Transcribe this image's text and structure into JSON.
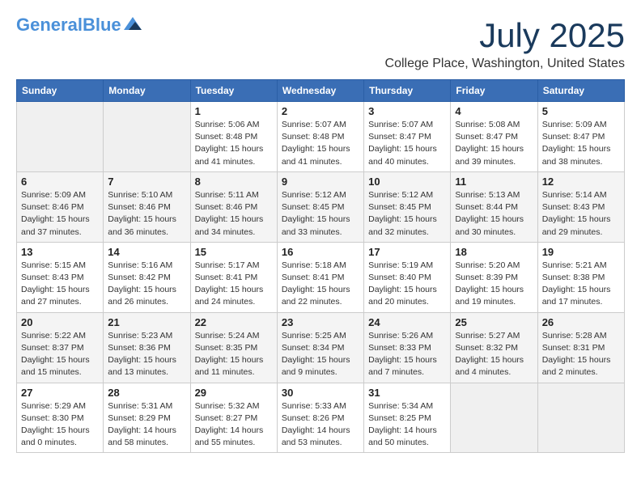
{
  "header": {
    "logo_general": "General",
    "logo_blue": "Blue",
    "month_title": "July 2025",
    "location": "College Place, Washington, United States"
  },
  "days_of_week": [
    "Sunday",
    "Monday",
    "Tuesday",
    "Wednesday",
    "Thursday",
    "Friday",
    "Saturday"
  ],
  "weeks": [
    [
      {
        "day": "",
        "sunrise": "",
        "sunset": "",
        "daylight": ""
      },
      {
        "day": "",
        "sunrise": "",
        "sunset": "",
        "daylight": ""
      },
      {
        "day": "1",
        "sunrise": "Sunrise: 5:06 AM",
        "sunset": "Sunset: 8:48 PM",
        "daylight": "Daylight: 15 hours and 41 minutes."
      },
      {
        "day": "2",
        "sunrise": "Sunrise: 5:07 AM",
        "sunset": "Sunset: 8:48 PM",
        "daylight": "Daylight: 15 hours and 41 minutes."
      },
      {
        "day": "3",
        "sunrise": "Sunrise: 5:07 AM",
        "sunset": "Sunset: 8:47 PM",
        "daylight": "Daylight: 15 hours and 40 minutes."
      },
      {
        "day": "4",
        "sunrise": "Sunrise: 5:08 AM",
        "sunset": "Sunset: 8:47 PM",
        "daylight": "Daylight: 15 hours and 39 minutes."
      },
      {
        "day": "5",
        "sunrise": "Sunrise: 5:09 AM",
        "sunset": "Sunset: 8:47 PM",
        "daylight": "Daylight: 15 hours and 38 minutes."
      }
    ],
    [
      {
        "day": "6",
        "sunrise": "Sunrise: 5:09 AM",
        "sunset": "Sunset: 8:46 PM",
        "daylight": "Daylight: 15 hours and 37 minutes."
      },
      {
        "day": "7",
        "sunrise": "Sunrise: 5:10 AM",
        "sunset": "Sunset: 8:46 PM",
        "daylight": "Daylight: 15 hours and 36 minutes."
      },
      {
        "day": "8",
        "sunrise": "Sunrise: 5:11 AM",
        "sunset": "Sunset: 8:46 PM",
        "daylight": "Daylight: 15 hours and 34 minutes."
      },
      {
        "day": "9",
        "sunrise": "Sunrise: 5:12 AM",
        "sunset": "Sunset: 8:45 PM",
        "daylight": "Daylight: 15 hours and 33 minutes."
      },
      {
        "day": "10",
        "sunrise": "Sunrise: 5:12 AM",
        "sunset": "Sunset: 8:45 PM",
        "daylight": "Daylight: 15 hours and 32 minutes."
      },
      {
        "day": "11",
        "sunrise": "Sunrise: 5:13 AM",
        "sunset": "Sunset: 8:44 PM",
        "daylight": "Daylight: 15 hours and 30 minutes."
      },
      {
        "day": "12",
        "sunrise": "Sunrise: 5:14 AM",
        "sunset": "Sunset: 8:43 PM",
        "daylight": "Daylight: 15 hours and 29 minutes."
      }
    ],
    [
      {
        "day": "13",
        "sunrise": "Sunrise: 5:15 AM",
        "sunset": "Sunset: 8:43 PM",
        "daylight": "Daylight: 15 hours and 27 minutes."
      },
      {
        "day": "14",
        "sunrise": "Sunrise: 5:16 AM",
        "sunset": "Sunset: 8:42 PM",
        "daylight": "Daylight: 15 hours and 26 minutes."
      },
      {
        "day": "15",
        "sunrise": "Sunrise: 5:17 AM",
        "sunset": "Sunset: 8:41 PM",
        "daylight": "Daylight: 15 hours and 24 minutes."
      },
      {
        "day": "16",
        "sunrise": "Sunrise: 5:18 AM",
        "sunset": "Sunset: 8:41 PM",
        "daylight": "Daylight: 15 hours and 22 minutes."
      },
      {
        "day": "17",
        "sunrise": "Sunrise: 5:19 AM",
        "sunset": "Sunset: 8:40 PM",
        "daylight": "Daylight: 15 hours and 20 minutes."
      },
      {
        "day": "18",
        "sunrise": "Sunrise: 5:20 AM",
        "sunset": "Sunset: 8:39 PM",
        "daylight": "Daylight: 15 hours and 19 minutes."
      },
      {
        "day": "19",
        "sunrise": "Sunrise: 5:21 AM",
        "sunset": "Sunset: 8:38 PM",
        "daylight": "Daylight: 15 hours and 17 minutes."
      }
    ],
    [
      {
        "day": "20",
        "sunrise": "Sunrise: 5:22 AM",
        "sunset": "Sunset: 8:37 PM",
        "daylight": "Daylight: 15 hours and 15 minutes."
      },
      {
        "day": "21",
        "sunrise": "Sunrise: 5:23 AM",
        "sunset": "Sunset: 8:36 PM",
        "daylight": "Daylight: 15 hours and 13 minutes."
      },
      {
        "day": "22",
        "sunrise": "Sunrise: 5:24 AM",
        "sunset": "Sunset: 8:35 PM",
        "daylight": "Daylight: 15 hours and 11 minutes."
      },
      {
        "day": "23",
        "sunrise": "Sunrise: 5:25 AM",
        "sunset": "Sunset: 8:34 PM",
        "daylight": "Daylight: 15 hours and 9 minutes."
      },
      {
        "day": "24",
        "sunrise": "Sunrise: 5:26 AM",
        "sunset": "Sunset: 8:33 PM",
        "daylight": "Daylight: 15 hours and 7 minutes."
      },
      {
        "day": "25",
        "sunrise": "Sunrise: 5:27 AM",
        "sunset": "Sunset: 8:32 PM",
        "daylight": "Daylight: 15 hours and 4 minutes."
      },
      {
        "day": "26",
        "sunrise": "Sunrise: 5:28 AM",
        "sunset": "Sunset: 8:31 PM",
        "daylight": "Daylight: 15 hours and 2 minutes."
      }
    ],
    [
      {
        "day": "27",
        "sunrise": "Sunrise: 5:29 AM",
        "sunset": "Sunset: 8:30 PM",
        "daylight": "Daylight: 15 hours and 0 minutes."
      },
      {
        "day": "28",
        "sunrise": "Sunrise: 5:31 AM",
        "sunset": "Sunset: 8:29 PM",
        "daylight": "Daylight: 14 hours and 58 minutes."
      },
      {
        "day": "29",
        "sunrise": "Sunrise: 5:32 AM",
        "sunset": "Sunset: 8:27 PM",
        "daylight": "Daylight: 14 hours and 55 minutes."
      },
      {
        "day": "30",
        "sunrise": "Sunrise: 5:33 AM",
        "sunset": "Sunset: 8:26 PM",
        "daylight": "Daylight: 14 hours and 53 minutes."
      },
      {
        "day": "31",
        "sunrise": "Sunrise: 5:34 AM",
        "sunset": "Sunset: 8:25 PM",
        "daylight": "Daylight: 14 hours and 50 minutes."
      },
      {
        "day": "",
        "sunrise": "",
        "sunset": "",
        "daylight": ""
      },
      {
        "day": "",
        "sunrise": "",
        "sunset": "",
        "daylight": ""
      }
    ]
  ]
}
